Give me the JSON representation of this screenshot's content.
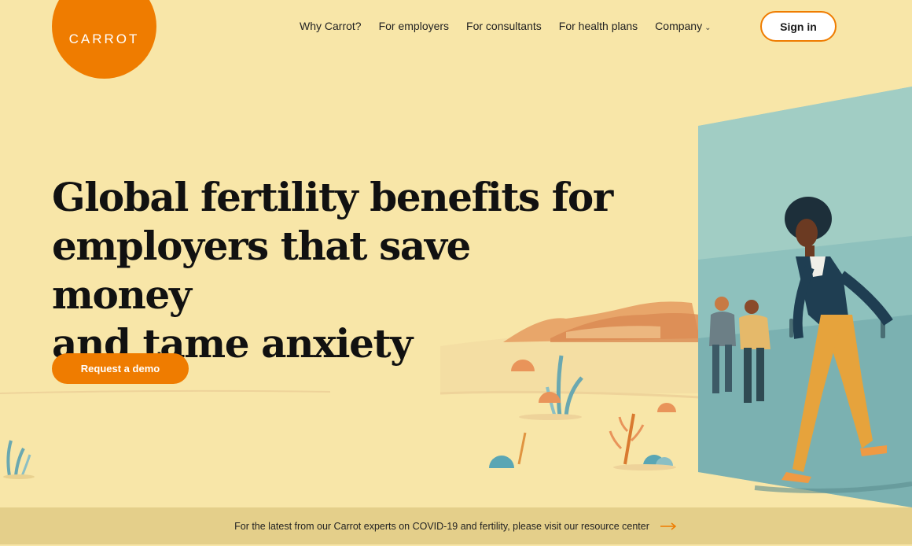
{
  "logo": {
    "text": "CARROT"
  },
  "nav": {
    "items": [
      {
        "label": "Why Carrot?"
      },
      {
        "label": "For employers"
      },
      {
        "label": "For consultants"
      },
      {
        "label": "For health plans"
      },
      {
        "label": "Company"
      }
    ],
    "signin_label": "Sign in"
  },
  "hero": {
    "headline_lines": [
      "Global fertility benefits for",
      "employers that save money",
      "and tame anxiety"
    ],
    "cta_label": "Request a demo"
  },
  "banner": {
    "text": "For the latest from our Carrot experts on COVID-19 and fertility, please visit our resource center"
  },
  "colors": {
    "background": "#f8e6a8",
    "accent": "#ef7c00",
    "banner": "#e4cf8a"
  },
  "icons": [
    "chevron-down-icon",
    "arrow-right-icon"
  ]
}
